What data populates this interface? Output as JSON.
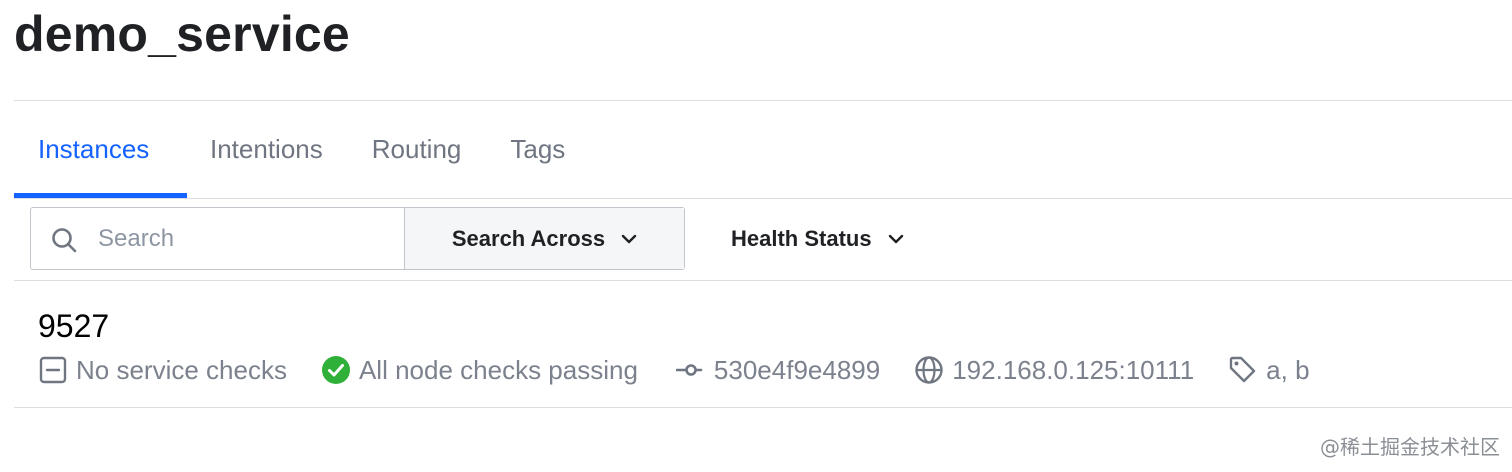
{
  "page": {
    "title": "demo_service"
  },
  "tabs": [
    {
      "label": "Instances",
      "active": true
    },
    {
      "label": "Intentions",
      "active": false
    },
    {
      "label": "Routing",
      "active": false
    },
    {
      "label": "Tags",
      "active": false
    }
  ],
  "toolbar": {
    "search_placeholder": "Search",
    "search_value": "",
    "search_across_label": "Search Across",
    "health_status_label": "Health Status"
  },
  "instances": [
    {
      "name": "9527",
      "service_checks": "No service checks",
      "node_checks": "All node checks passing",
      "node_id": "530e4f9e4899",
      "address": "192.168.0.125:10111",
      "tags": "a, b"
    }
  ],
  "watermark": "@稀土掘金技术社区",
  "colors": {
    "accent": "#1563ff",
    "passing": "#2eb039",
    "muted_text": "#7c828d",
    "divider": "#dcdee2"
  },
  "icons": [
    "search-icon",
    "chevron-down-icon",
    "minus-square-icon",
    "check-circle-icon",
    "git-commit-icon",
    "globe-icon",
    "tag-icon"
  ]
}
